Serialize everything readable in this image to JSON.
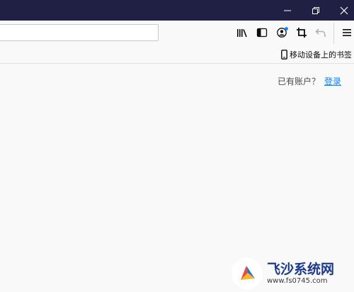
{
  "window": {
    "controls": [
      "minimize-icon",
      "restore-icon",
      "close-icon"
    ],
    "titlebar_color": "#1f2044"
  },
  "toolbar": {
    "url_value": "",
    "icons": [
      "library-icon",
      "sidebar-icon",
      "account-icon",
      "screenshot-crop-icon",
      "undo-icon",
      "menu-icon"
    ],
    "account_badge_color": "#0a84ff"
  },
  "bookmarks": {
    "mobile_label": "移动设备上的书签",
    "mobile_icon": "mobile-device-icon"
  },
  "content": {
    "account_prompt": "已有账户？",
    "login_link": "登录",
    "link_color": "#0a84ff"
  },
  "watermark": {
    "title": "飞沙系统网",
    "url": "www.fs0745.com"
  }
}
